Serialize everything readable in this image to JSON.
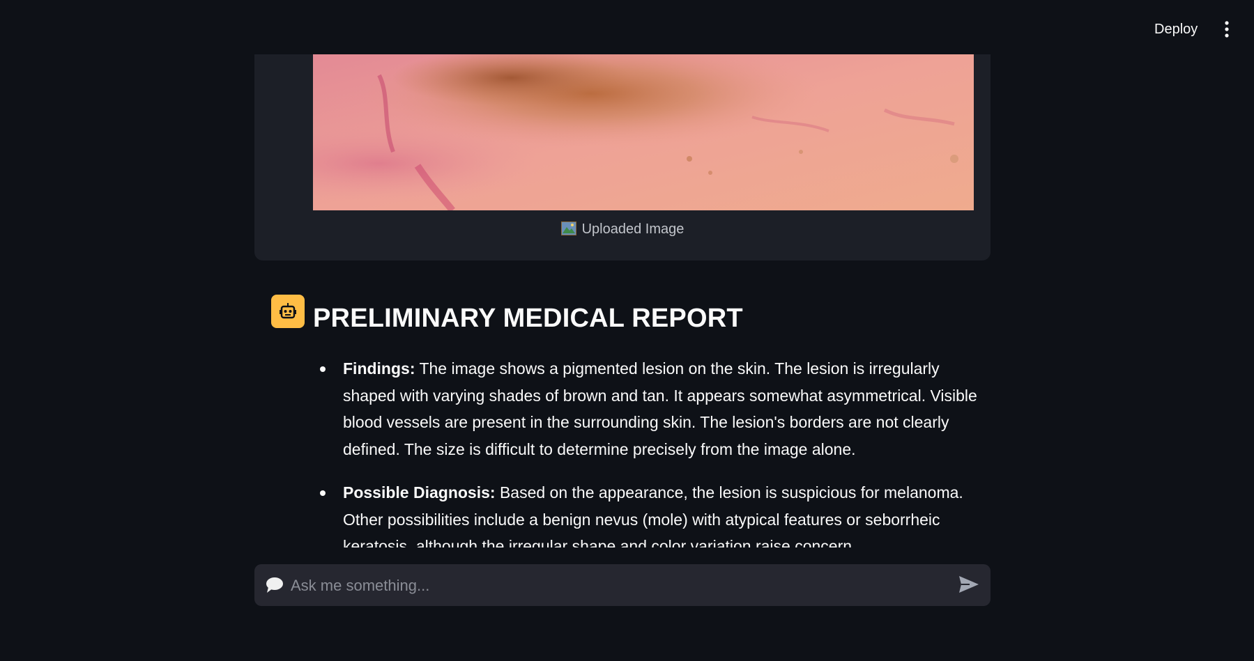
{
  "header": {
    "deploy_label": "Deploy"
  },
  "image_card": {
    "caption_icon": "framed-picture-icon",
    "caption": "Uploaded Image"
  },
  "report": {
    "avatar_icon": "robot-icon",
    "avatar_color": "#ffbd45",
    "title": "PRELIMINARY MEDICAL REPORT",
    "items": [
      {
        "label": "Findings:",
        "text": "The image shows a pigmented lesion on the skin. The lesion is irregularly shaped with varying shades of brown and tan. It appears somewhat asymmetrical. Visible blood vessels are present in the surrounding skin. The lesion's borders are not clearly defined. The size is difficult to determine precisely from the image alone."
      },
      {
        "label": "Possible Diagnosis:",
        "text": "Based on the appearance, the lesion is suspicious for melanoma. Other possibilities include a benign nevus (mole) with atypical features or seborrheic keratosis, although the irregular shape and color variation raise concern."
      }
    ]
  },
  "chat": {
    "placeholder": "Ask me something...",
    "input_value": ""
  },
  "colors": {
    "background": "#0e1117",
    "card": "#1c1f27",
    "input": "#262730"
  }
}
